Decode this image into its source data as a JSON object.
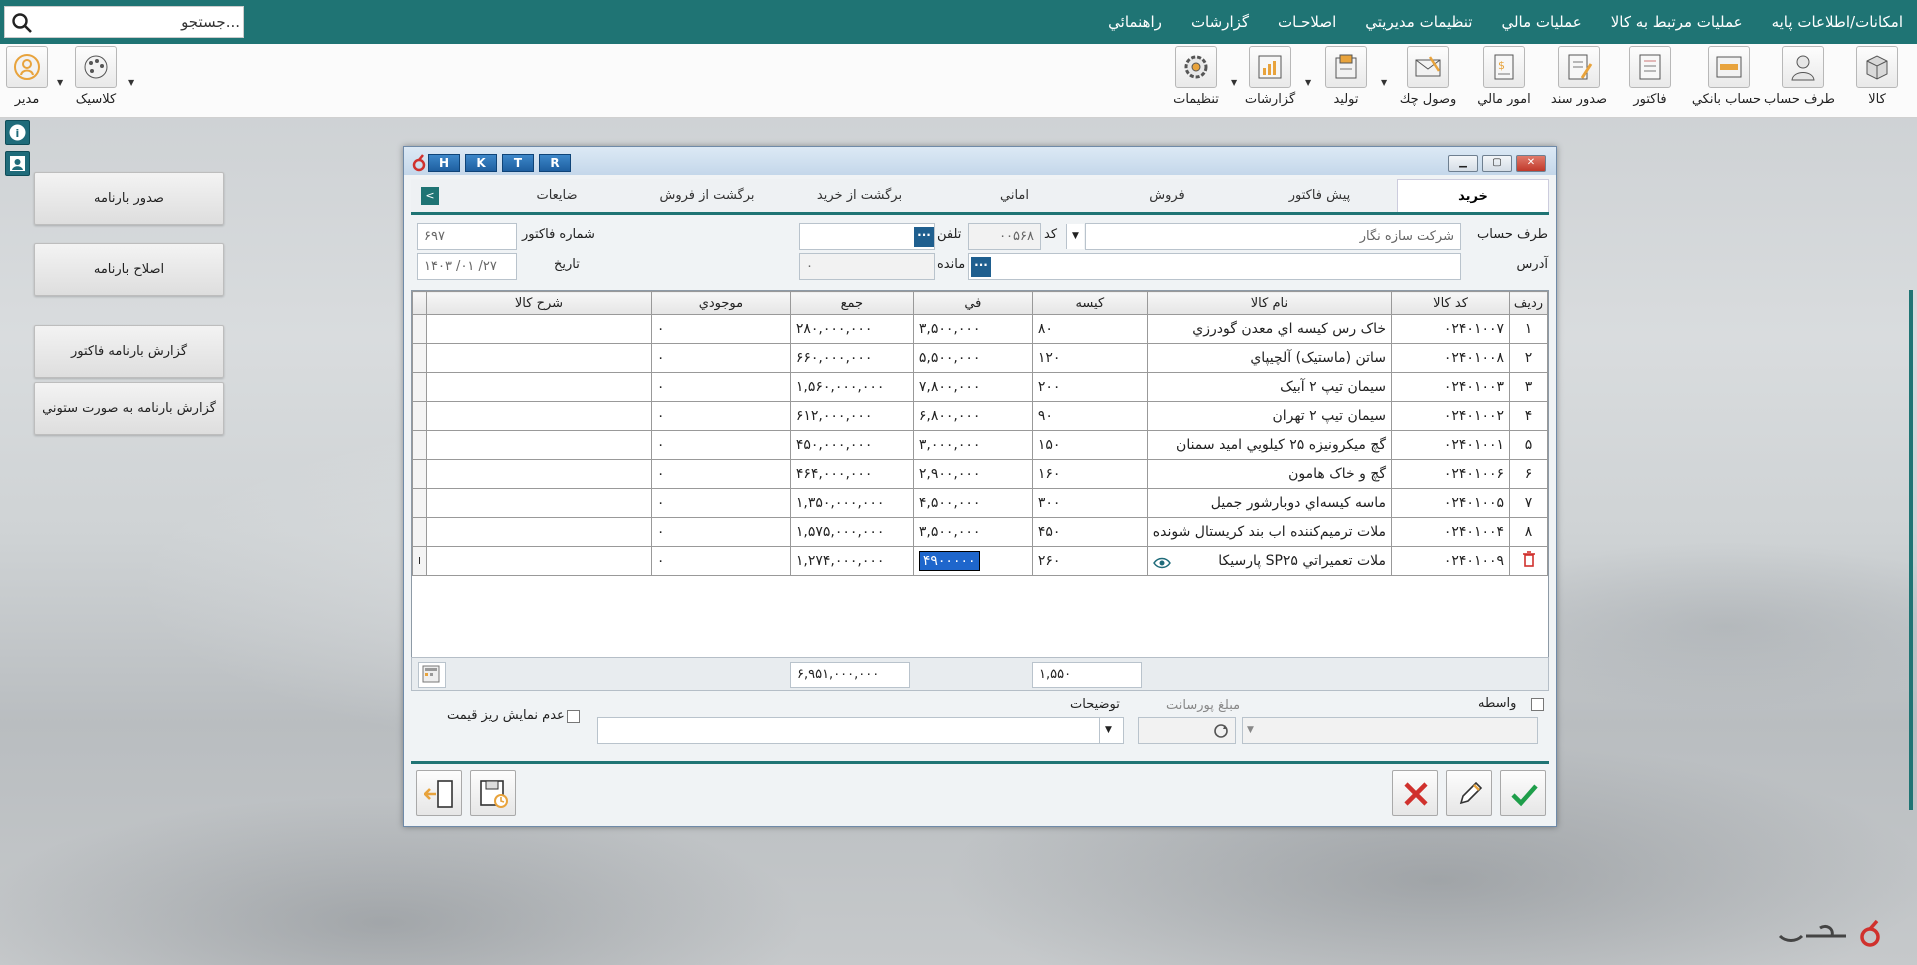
{
  "menu": {
    "items": [
      "امکانات/اطلاعات پايه",
      "عمليات مرتبط به کالا",
      "عمليات مالي",
      "تنظيمات مديريتي",
      "اصلاحـات",
      "گزارشات",
      "راهنمائي"
    ],
    "search_placeholder": "جستجو..."
  },
  "toolbar": {
    "buttons": [
      "کالا",
      "طرف حساب",
      "حساب بانکي",
      "فاکتور",
      "صدور سند",
      "امور مالي",
      "وصول چك",
      "توليد",
      "گزارشات",
      "تنظيمات"
    ],
    "left_buttons": [
      "کلاسيک",
      "مدير"
    ]
  },
  "sidebar": {
    "buttons": [
      "صدور بارنامه",
      "اصلاح بارنامه",
      "گزارش بارنامه فاکتور",
      "گزارش بارنامه به صورت ستوني"
    ]
  },
  "dialog": {
    "hotkeys": [
      "H",
      "K",
      "T",
      "R"
    ],
    "tabs": [
      "خريد",
      "پيش فاكتور",
      "فروش",
      "اماني",
      "برگشت از خريد",
      "برگشت از فروش",
      "ضايعات"
    ],
    "form": {
      "account_label": "طرف حساب",
      "account_value": "شرکت سازه نگار",
      "code_label": "کد",
      "code_value": "۰۰۵۶۸",
      "phone_label": "تلفن",
      "phone_value": "",
      "invoice_no_label": "شماره فاکتور",
      "invoice_no_value": "۶۹۷",
      "address_label": "آدرس",
      "address_value": "",
      "balance_label": "مانده",
      "balance_value": "۰",
      "date_label": "تاريخ",
      "date_value": "۱۴۰۳ /۰۱ /۲۷"
    },
    "grid": {
      "headers": [
        "رديف",
        "کد کالا",
        "نام کالا",
        "کيسه",
        "في",
        "جمع",
        "موجودي",
        "شرح کالا"
      ],
      "rows": [
        {
          "row": "۱",
          "code": "۰۲۴۰۱۰۰۷",
          "name": "خاک رس کيسه اي معدن گودرزي",
          "qty": "۸۰",
          "price": "۳,۵۰۰,۰۰۰",
          "sum": "۲۸۰,۰۰۰,۰۰۰",
          "stock": "۰",
          "desc": ""
        },
        {
          "row": "۲",
          "code": "۰۲۴۰۱۰۰۸",
          "name": "ساتن (ماستيک) آلچيپاي",
          "qty": "۱۲۰",
          "price": "۵,۵۰۰,۰۰۰",
          "sum": "۶۶۰,۰۰۰,۰۰۰",
          "stock": "۰",
          "desc": ""
        },
        {
          "row": "۳",
          "code": "۰۲۴۰۱۰۰۳",
          "name": "سيمان تيپ ۲ آبيک",
          "qty": "۲۰۰",
          "price": "۷,۸۰۰,۰۰۰",
          "sum": "۱,۵۶۰,۰۰۰,۰۰۰",
          "stock": "۰",
          "desc": ""
        },
        {
          "row": "۴",
          "code": "۰۲۴۰۱۰۰۲",
          "name": "سيمان تيپ ۲ تهران",
          "qty": "۹۰",
          "price": "۶,۸۰۰,۰۰۰",
          "sum": "۶۱۲,۰۰۰,۰۰۰",
          "stock": "۰",
          "desc": ""
        },
        {
          "row": "۵",
          "code": "۰۲۴۰۱۰۰۱",
          "name": "گچ ميکرونيزه ۲۵ کيلويي اميد سمنان",
          "qty": "۱۵۰",
          "price": "۳,۰۰۰,۰۰۰",
          "sum": "۴۵۰,۰۰۰,۰۰۰",
          "stock": "۰",
          "desc": ""
        },
        {
          "row": "۶",
          "code": "۰۲۴۰۱۰۰۶",
          "name": "گچ و خاک هامون",
          "qty": "۱۶۰",
          "price": "۲,۹۰۰,۰۰۰",
          "sum": "۴۶۴,۰۰۰,۰۰۰",
          "stock": "۰",
          "desc": ""
        },
        {
          "row": "۷",
          "code": "۰۲۴۰۱۰۰۵",
          "name": "ماسه کيسه‌اي دوبارشور جميل",
          "qty": "۳۰۰",
          "price": "۴,۵۰۰,۰۰۰",
          "sum": "۱,۳۵۰,۰۰۰,۰۰۰",
          "stock": "۰",
          "desc": ""
        },
        {
          "row": "۸",
          "code": "۰۲۴۰۱۰۰۴",
          "name": "ملات ترميم‌کننده اب بند کريستال شونده",
          "qty": "۴۵۰",
          "price": "۳,۵۰۰,۰۰۰",
          "sum": "۱,۵۷۵,۰۰۰,۰۰۰",
          "stock": "۰",
          "desc": ""
        },
        {
          "row": "",
          "code": "۰۲۴۰۱۰۰۹",
          "name": "ملات تعميراتي SP۲۵ پارسيکا",
          "qty": "۲۶۰",
          "price": "۴۹۰۰۰۰۰",
          "sum": "۱,۲۷۴,۰۰۰,۰۰۰",
          "stock": "۰",
          "desc": ""
        }
      ]
    },
    "totals": {
      "qty_total": "۱,۵۵۰",
      "sum_total": "۶,۹۵۱,۰۰۰,۰۰۰"
    },
    "footer": {
      "broker_label": "واسطه",
      "commission_label": "مبلغ پورسانت",
      "notes_label": "توضيحات",
      "notes_value": "+",
      "hide_price_label": "عدم نمايش ريز قيمت"
    }
  },
  "colors": {
    "brand": "#1f7474",
    "accent_blue": "#1e66cc",
    "cancel_red": "#d0312d",
    "confirm_green": "#1e9e4a"
  },
  "icons": [
    "search-icon",
    "info-icon",
    "user-card-icon",
    "delete-row-icon",
    "view-eye-icon",
    "cancel-icon",
    "edit-icon",
    "confirm-icon",
    "save-icon",
    "exit-icon",
    "calculator-icon"
  ]
}
